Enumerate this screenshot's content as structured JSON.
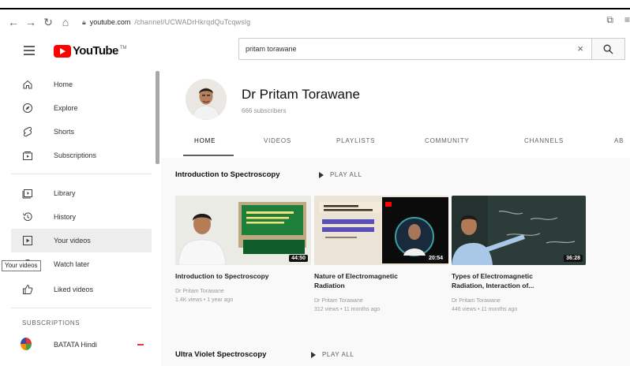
{
  "browser": {
    "url_host": "youtube.com",
    "url_path": "/channel/UCWADrHkrqdQuTcqwslg",
    "icons": [
      "back-arrow",
      "forward-arrow",
      "reload",
      "home",
      "lock",
      "share",
      "extensions"
    ]
  },
  "masthead": {
    "logo_text": "YouTube",
    "logo_tm": "TM",
    "search_value": "pritam torawane",
    "search_clear": "×"
  },
  "sidebar": {
    "items": [
      {
        "label": "Home",
        "icon": "home-icon"
      },
      {
        "label": "Explore",
        "icon": "compass-icon"
      },
      {
        "label": "Shorts",
        "icon": "shorts-icon"
      },
      {
        "label": "Subscriptions",
        "icon": "subscriptions-icon"
      },
      {
        "label": "Library",
        "icon": "library-icon"
      },
      {
        "label": "History",
        "icon": "history-icon"
      },
      {
        "label": "Your videos",
        "icon": "play-square-icon"
      },
      {
        "label": "Watch later",
        "icon": "clock-icon"
      },
      {
        "label": "Liked videos",
        "icon": "thumbs-up-icon"
      }
    ],
    "tooltip": "Your videos",
    "subscriptions_heading": "SUBSCRIPTIONS",
    "subscriptions": [
      {
        "label": "BATATA Hindi"
      }
    ]
  },
  "channel": {
    "name": "Dr Pritam Torawane",
    "subscribers": "666 subscribers",
    "tabs": [
      "HOME",
      "VIDEOS",
      "PLAYLISTS",
      "COMMUNITY",
      "CHANNELS",
      "AB"
    ],
    "active_tab": "HOME"
  },
  "shelves": [
    {
      "title": "Introduction to Spectroscopy",
      "play_all": "PLAY ALL",
      "videos": [
        {
          "title_line1": "Introduction to Spectroscopy",
          "title_line2": "",
          "channel": "Dr Pritam Torawane",
          "meta": "1.4K views • 1 year ago",
          "duration": "44:50"
        },
        {
          "title_line1": "Nature of Electromagnetic",
          "title_line2": "Radiation",
          "channel": "Dr Pritam Torawane",
          "meta": "312 views • 11 months ago",
          "duration": "20:54"
        },
        {
          "title_line1": "Types of Electromagnetic",
          "title_line2": "Radiation, Interaction of...",
          "channel": "Dr Pritam Torawane",
          "meta": "446 views • 11 months ago",
          "duration": "36:28"
        }
      ]
    },
    {
      "title": "Ultra Violet Spectroscopy",
      "play_all": "PLAY ALL"
    }
  ],
  "colors": {
    "brand_red": "#ff0000",
    "chalkboard": "#1d7f3a",
    "dark_board": "#24312f"
  }
}
